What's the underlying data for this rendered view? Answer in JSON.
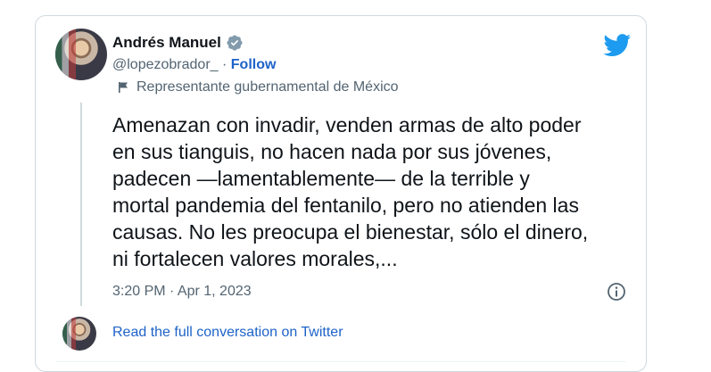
{
  "tweet": {
    "author_name": "Andrés Manuel",
    "handle": "@lopezobrador_",
    "separator": "·",
    "follow_label": "Follow",
    "gov_label": "Representante gubernamental de México",
    "text": "Amenazan con invadir, venden armas de alto poder\nen sus tianguis, no hacen nada por sus jóvenes,\npadecen —lamentablemente— de la terrible y\nmortal pandemia del fentanilo, pero no atienden las\ncausas. No les preocupa el bienestar, sólo el dinero,\nni fortalecen valores morales,...",
    "timestamp": "3:20 PM · Apr 1, 2023",
    "read_more": "Read the full conversation on Twitter"
  },
  "icons": {
    "verified": "verified-badge-icon",
    "bird": "twitter-bird-icon",
    "flag": "flag-icon",
    "info": "info-icon"
  },
  "colors": {
    "link": "#1d63c9",
    "twitter_blue": "#1d9bf0",
    "text": "#0f1419",
    "secondary": "#536471",
    "border": "#cfd9de"
  }
}
